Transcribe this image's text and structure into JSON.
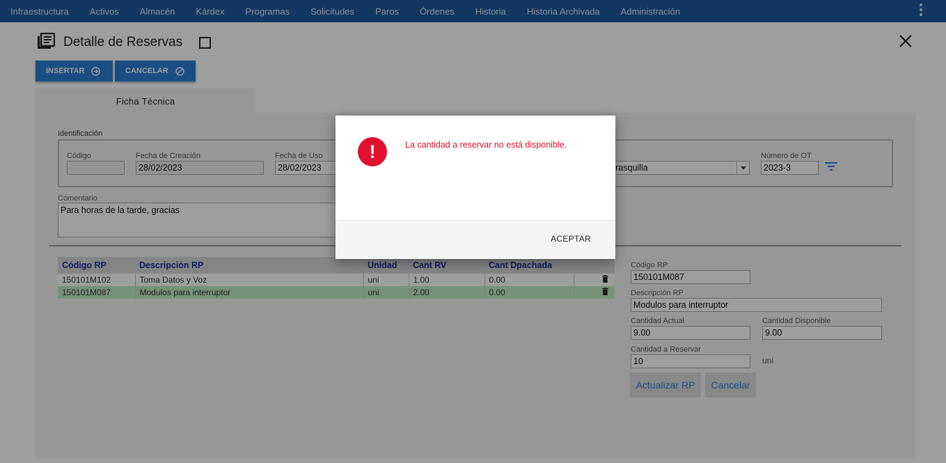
{
  "nav": {
    "items": [
      "Infraestructura",
      "Activos",
      "Almacén",
      "Kárdex",
      "Programas",
      "Solicitudes",
      "Paros",
      "Órdenes",
      "Historia",
      "Historia Archivada",
      "Administración"
    ]
  },
  "header": {
    "title": "Detalle de Reservas"
  },
  "toolbar": {
    "insert_label": "INSERTAR",
    "cancel_label": "CANCELAR"
  },
  "tabs": [
    {
      "label": "Ficha Técnica"
    }
  ],
  "identificacion": {
    "section_label": "Identificación",
    "codigo": {
      "label": "Código",
      "value": ""
    },
    "fecha_creacion": {
      "label": "Fecha de Creación",
      "value": "28/02/2023"
    },
    "fecha_uso": {
      "label": "Fecha de Uso",
      "value": "28/02/2023"
    },
    "solicitante": {
      "value": "Carrasquilla"
    },
    "numero_ot": {
      "label": "Número de OT",
      "value": "2023-3"
    }
  },
  "comentario": {
    "label": "Comentario",
    "value": "Para horas de la tarde, gracias"
  },
  "table": {
    "headers": [
      "Código RP",
      "Descripción RP",
      "Unidad",
      "Cant RV",
      "Cant Dpachada"
    ],
    "rows": [
      {
        "codigo": "150101M102",
        "descripcion": "Toma Datos y Voz",
        "unidad": "uni",
        "cant_rv": "1.00",
        "cant_desp": "0.00"
      },
      {
        "codigo": "150101M087",
        "descripcion": "Modulos para interruptor",
        "unidad": "uni",
        "cant_rv": "2.00",
        "cant_desp": "0.00"
      }
    ]
  },
  "detail": {
    "codigo_rp": {
      "label": "Código RP",
      "value": "150101M087"
    },
    "descripcion_rp": {
      "label": "Descripción RP",
      "value": "Modulos para interruptor"
    },
    "cantidad_actual": {
      "label": "Cantidad Actual",
      "value": "9.00"
    },
    "cantidad_disponible": {
      "label": "Cantidad Disponible",
      "value": "9.00"
    },
    "cantidad_reservar": {
      "label": "Cantidad a Reservar",
      "value": "10",
      "unit": "uni"
    },
    "update_label": "Actualizar RP",
    "cancel_label": "Cancelar"
  },
  "modal": {
    "message": "La cantidad a reservar no está disponible.",
    "accept_label": "ACEPTAR"
  },
  "colors": {
    "nav": "#1e5aa0",
    "accent": "#2a7fd4",
    "error": "#e0102e",
    "selected_row": "#bdecc0"
  }
}
